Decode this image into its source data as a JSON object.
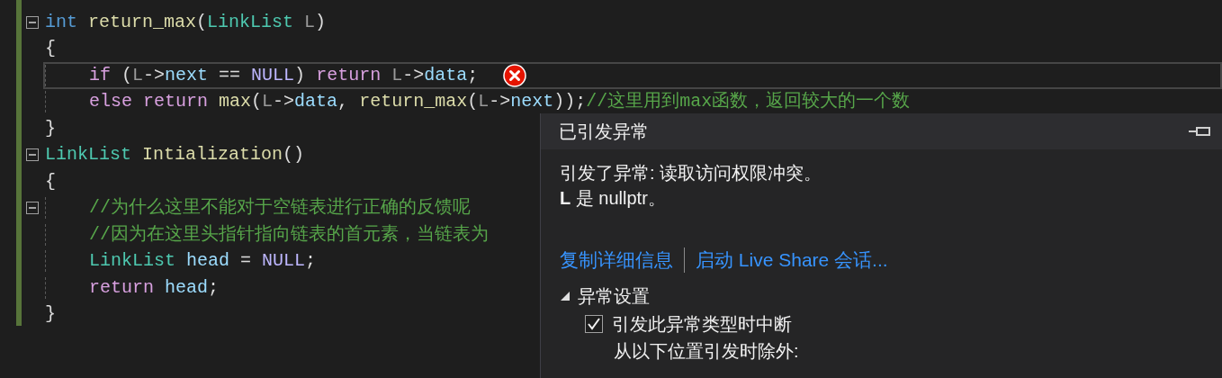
{
  "editor": {
    "lines": [
      {
        "fold_marker": true,
        "current": false,
        "error": false,
        "indent": false,
        "tokens": [
          {
            "text": "int ",
            "kind": "keyword"
          },
          {
            "text": "return_max",
            "kind": "function"
          },
          {
            "text": "(",
            "kind": "plain"
          },
          {
            "text": "LinkList ",
            "kind": "type"
          },
          {
            "text": "L",
            "kind": "param"
          },
          {
            "text": ")",
            "kind": "plain"
          }
        ]
      },
      {
        "fold_marker": false,
        "current": false,
        "error": false,
        "indent": false,
        "tokens": [
          {
            "text": "{",
            "kind": "plain"
          }
        ]
      },
      {
        "fold_marker": false,
        "current": true,
        "error": true,
        "indent": true,
        "tokens": [
          {
            "text": "if",
            "kind": "control"
          },
          {
            "text": " (",
            "kind": "plain"
          },
          {
            "text": "L",
            "kind": "param"
          },
          {
            "text": "->",
            "kind": "plain"
          },
          {
            "text": "next",
            "kind": "variable"
          },
          {
            "text": " == ",
            "kind": "plain"
          },
          {
            "text": "NULL",
            "kind": "macro"
          },
          {
            "text": ") ",
            "kind": "plain"
          },
          {
            "text": "return ",
            "kind": "control"
          },
          {
            "text": "L",
            "kind": "param"
          },
          {
            "text": "->",
            "kind": "plain"
          },
          {
            "text": "data",
            "kind": "variable"
          },
          {
            "text": ";",
            "kind": "plain"
          }
        ]
      },
      {
        "fold_marker": false,
        "current": false,
        "error": false,
        "indent": true,
        "tokens": [
          {
            "text": "else return ",
            "kind": "control"
          },
          {
            "text": "max",
            "kind": "function"
          },
          {
            "text": "(",
            "kind": "plain"
          },
          {
            "text": "L",
            "kind": "param"
          },
          {
            "text": "->",
            "kind": "plain"
          },
          {
            "text": "data",
            "kind": "variable"
          },
          {
            "text": ", ",
            "kind": "plain"
          },
          {
            "text": "return_max",
            "kind": "function"
          },
          {
            "text": "(",
            "kind": "plain"
          },
          {
            "text": "L",
            "kind": "param"
          },
          {
            "text": "->",
            "kind": "plain"
          },
          {
            "text": "next",
            "kind": "variable"
          },
          {
            "text": "));",
            "kind": "plain"
          },
          {
            "text": "//这里用到max函数，返回较大的一个数",
            "kind": "comment"
          }
        ]
      },
      {
        "fold_marker": false,
        "current": false,
        "error": false,
        "indent": false,
        "tokens": [
          {
            "text": "}",
            "kind": "plain"
          }
        ]
      },
      {
        "fold_marker": true,
        "current": false,
        "error": false,
        "indent": false,
        "tokens": [
          {
            "text": "LinkList ",
            "kind": "type"
          },
          {
            "text": "Intialization",
            "kind": "function"
          },
          {
            "text": "()",
            "kind": "plain"
          }
        ]
      },
      {
        "fold_marker": false,
        "current": false,
        "error": false,
        "indent": false,
        "tokens": [
          {
            "text": "{",
            "kind": "plain"
          }
        ]
      },
      {
        "fold_marker": true,
        "current": false,
        "error": false,
        "indent": true,
        "tokens": [
          {
            "text": "//为什么这里不能对于空链表进行正确的反馈呢",
            "kind": "comment"
          }
        ]
      },
      {
        "fold_marker": false,
        "current": false,
        "error": false,
        "indent": true,
        "tokens": [
          {
            "text": "//因为在这里头指针指向链表的首元素，当链表为",
            "kind": "comment"
          }
        ]
      },
      {
        "fold_marker": false,
        "current": false,
        "error": false,
        "indent": true,
        "tokens": [
          {
            "text": "LinkList ",
            "kind": "type"
          },
          {
            "text": "head",
            "kind": "variable"
          },
          {
            "text": " = ",
            "kind": "plain"
          },
          {
            "text": "NULL",
            "kind": "macro"
          },
          {
            "text": ";",
            "kind": "plain"
          }
        ]
      },
      {
        "fold_marker": false,
        "current": false,
        "error": false,
        "indent": true,
        "tokens": [
          {
            "text": "return ",
            "kind": "control"
          },
          {
            "text": "head",
            "kind": "variable"
          },
          {
            "text": ";",
            "kind": "plain"
          }
        ]
      },
      {
        "fold_marker": false,
        "current": false,
        "error": false,
        "indent": false,
        "tokens": [
          {
            "text": "}",
            "kind": "plain"
          }
        ]
      }
    ]
  },
  "exception_popup": {
    "title": "已引发异常",
    "message": [
      "引发了异常: 读取访问权限冲突。",
      "**L** 是 nullptr。"
    ],
    "links": [
      "复制详细信息",
      "启动 Live Share 会话..."
    ],
    "settings": {
      "label": "异常设置",
      "expanded": true,
      "checkbox": {
        "label": "引发此异常类型时中断",
        "checked": true
      },
      "note": "从以下位置引发时除外:"
    }
  }
}
